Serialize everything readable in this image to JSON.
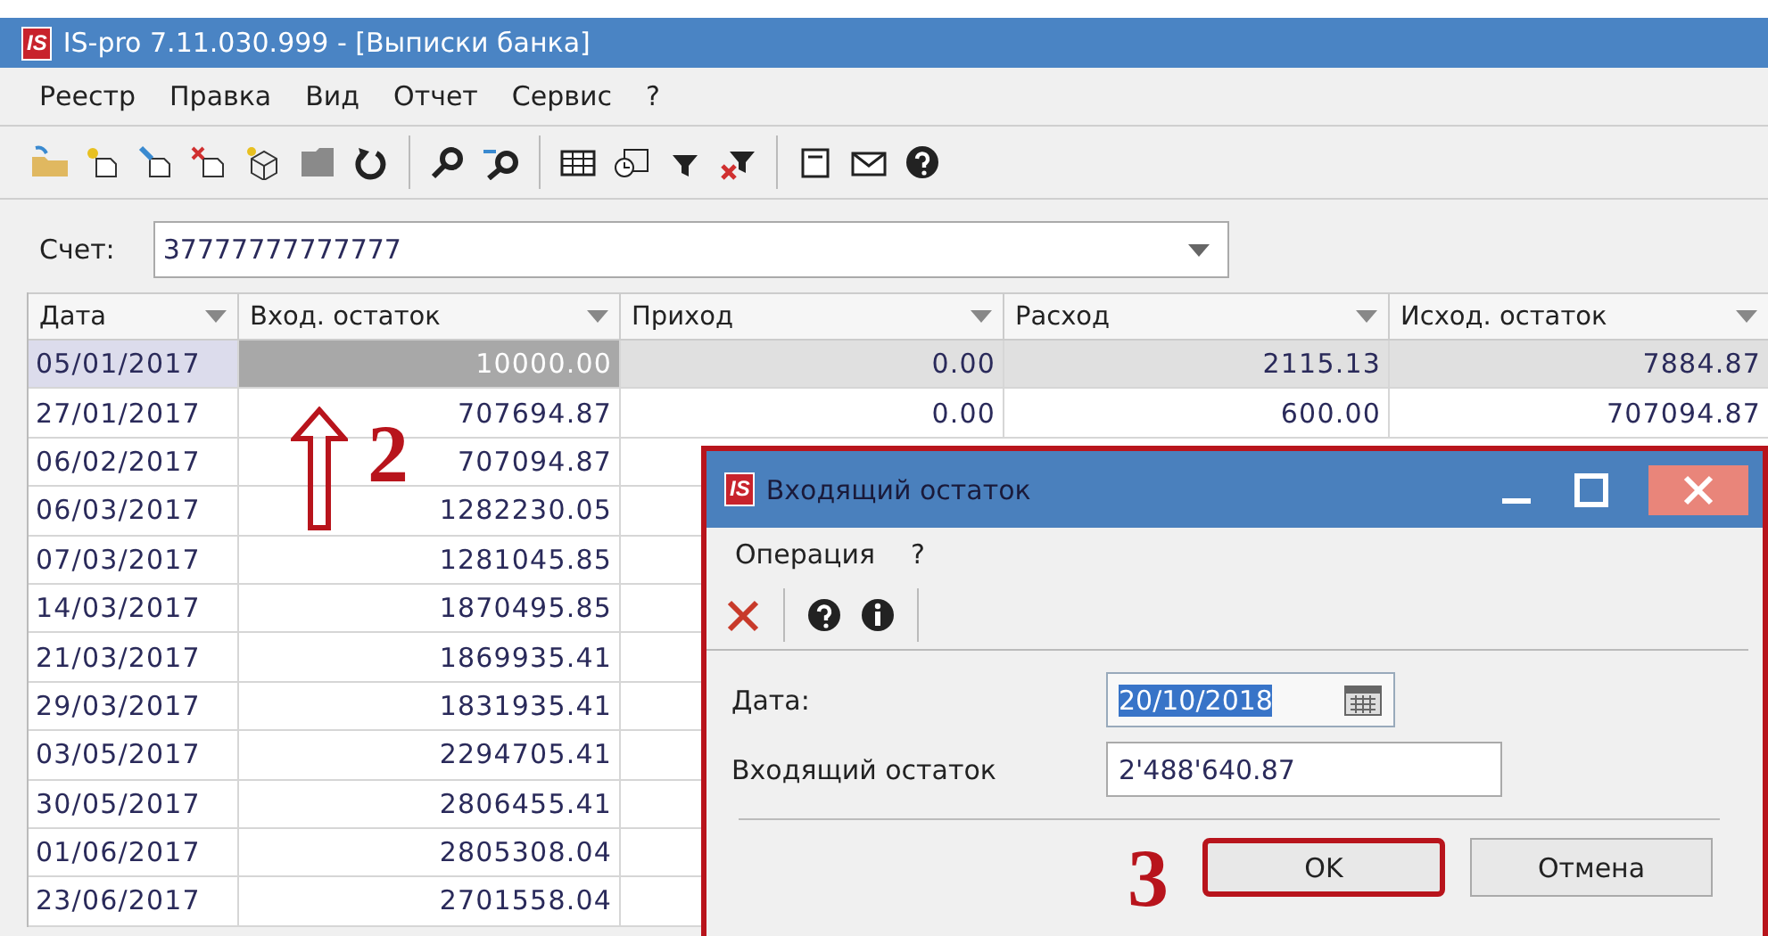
{
  "window": {
    "logo": "IS",
    "title": "IS-pro 7.11.030.999 - [Выписки банка]"
  },
  "menu": [
    "Реестр",
    "Правка",
    "Вид",
    "Отчет",
    "Сервис",
    "?"
  ],
  "account": {
    "label": "Счет:",
    "value": "37777777777777"
  },
  "table": {
    "columns": [
      "Дата",
      "Вход. остаток",
      "Приход",
      "Расход",
      "Исход. остаток"
    ],
    "rows": [
      {
        "selected": true,
        "cells": [
          "05/01/2017",
          "10000.00",
          "0.00",
          "2115.13",
          "7884.87"
        ]
      },
      {
        "selected": false,
        "cells": [
          "27/01/2017",
          "707694.87",
          "0.00",
          "600.00",
          "707094.87"
        ]
      },
      {
        "selected": false,
        "cells": [
          "06/02/2017",
          "707094.87"
        ]
      },
      {
        "selected": false,
        "cells": [
          "06/03/2017",
          "1282230.05"
        ]
      },
      {
        "selected": false,
        "cells": [
          "07/03/2017",
          "1281045.85"
        ]
      },
      {
        "selected": false,
        "cells": [
          "14/03/2017",
          "1870495.85"
        ]
      },
      {
        "selected": false,
        "cells": [
          "21/03/2017",
          "1869935.41"
        ]
      },
      {
        "selected": false,
        "cells": [
          "29/03/2017",
          "1831935.41"
        ]
      },
      {
        "selected": false,
        "cells": [
          "03/05/2017",
          "2294705.41"
        ]
      },
      {
        "selected": false,
        "cells": [
          "30/05/2017",
          "2806455.41"
        ]
      },
      {
        "selected": false,
        "cells": [
          "01/06/2017",
          "2805308.04"
        ]
      },
      {
        "selected": false,
        "cells": [
          "23/06/2017",
          "2701558.04"
        ]
      }
    ]
  },
  "dialog": {
    "logo": "IS",
    "title": "Входящий остаток",
    "menu": [
      "Операция",
      "?"
    ],
    "fields": [
      {
        "kind": "date",
        "label": "Дата:",
        "value": "20/10/2018",
        "highlighted": true
      },
      {
        "kind": "text",
        "label": "Входящий остаток",
        "value": "2'488'640.87",
        "highlighted": false
      }
    ],
    "buttons": [
      {
        "label": "OK",
        "highlighted": true
      },
      {
        "label": "Отмена",
        "highlighted": false
      }
    ]
  },
  "annotations": [
    {
      "kind": "arrow",
      "label": "2"
    },
    {
      "kind": "plain",
      "label": "3"
    }
  ]
}
